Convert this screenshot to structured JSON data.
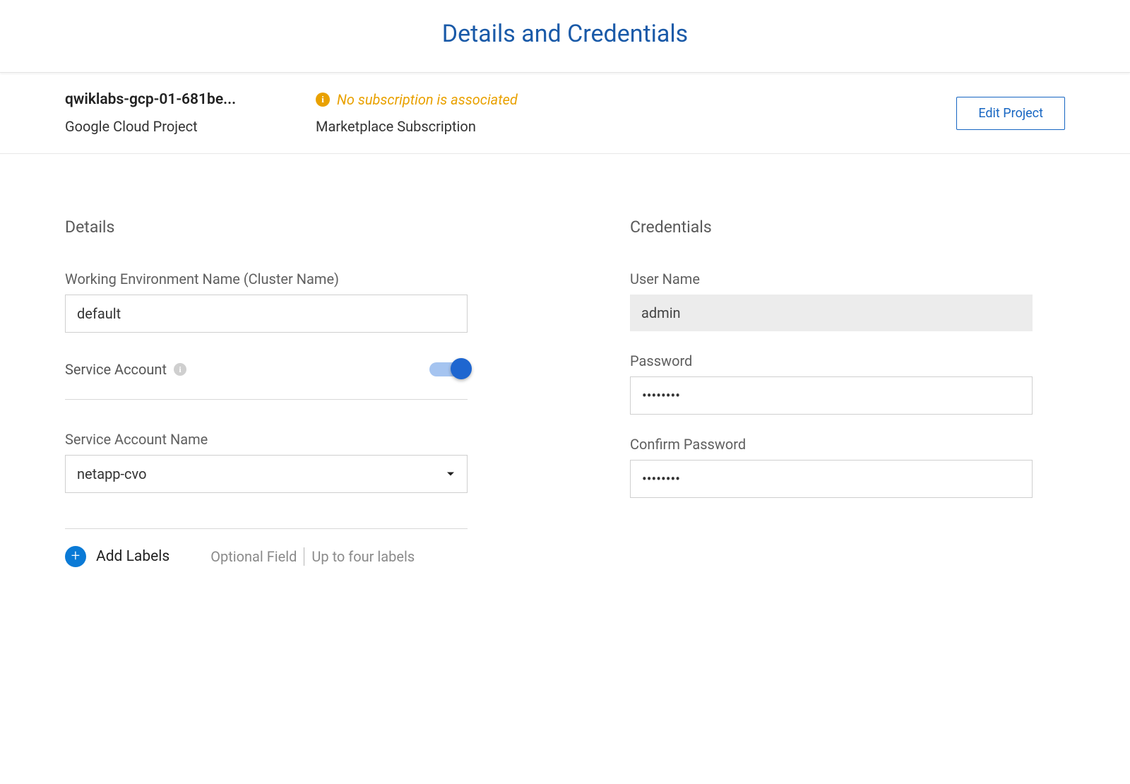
{
  "header": {
    "title": "Details and Credentials"
  },
  "info_bar": {
    "project_name": "qwiklabs-gcp-01-681be...",
    "project_type": "Google Cloud Project",
    "subscription_status": "No subscription is associated",
    "subscription_label": "Marketplace Subscription",
    "edit_button": "Edit Project"
  },
  "details": {
    "section_title": "Details",
    "env_name_label": "Working Environment Name (Cluster Name)",
    "env_name_value": "default",
    "service_account_toggle_label": "Service Account",
    "service_account_toggle_on": true,
    "service_account_name_label": "Service Account Name",
    "service_account_name_value": "netapp-cvo",
    "add_labels_text": "Add Labels",
    "optional_hint_1": "Optional Field",
    "optional_hint_2": "Up to four labels"
  },
  "credentials": {
    "section_title": "Credentials",
    "username_label": "User Name",
    "username_value": "admin",
    "password_label": "Password",
    "password_value": "••••••••",
    "confirm_label": "Confirm Password",
    "confirm_value": "••••••••"
  }
}
